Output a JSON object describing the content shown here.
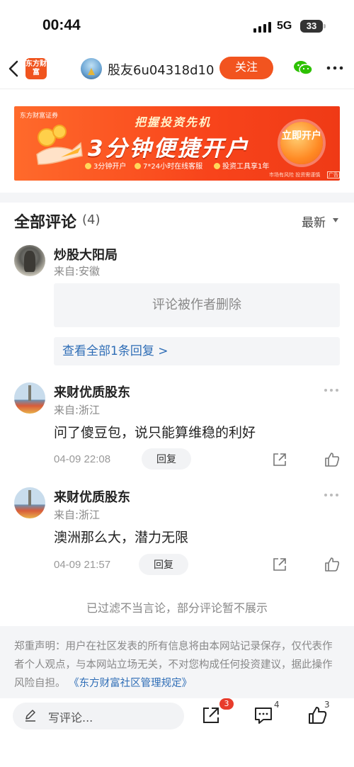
{
  "status_bar": {
    "time": "00:44",
    "network": "5G",
    "battery": "33"
  },
  "nav": {
    "logo_text": "东方财富",
    "username": "股友6u04318d10",
    "follow_label": "关注"
  },
  "banner": {
    "brand": "东方财富证券",
    "subtitle": "把握投资先机",
    "title": "3分钟便捷开户",
    "features": [
      "3分钟开户",
      "7*24小时在线客服",
      "投资工具享1年"
    ],
    "cta": "立即开户",
    "risk_note": "市场有风险 投资需谨慎",
    "ad_tag": "广告"
  },
  "comments_header": {
    "title": "全部评论",
    "count": "(4)",
    "sort_label": "最新"
  },
  "comments": [
    {
      "user": "炒股大阳局",
      "location": "来自:安徽",
      "deleted_text": "评论被作者删除",
      "view_replies": "查看全部1条回复 >"
    },
    {
      "user": "来财优质股东",
      "location": "来自:浙江",
      "text": "问了傻豆包，说只能算维稳的利好",
      "time": "04-09 22:08",
      "reply_label": "回复"
    },
    {
      "user": "来财优质股东",
      "location": "来自:浙江",
      "text": "澳洲那么大，潜力无限",
      "time": "04-09 21:57",
      "reply_label": "回复"
    }
  ],
  "filtered_notice": "已过滤不当言论，部分评论暂不展示",
  "disclaimer": {
    "text": "郑重声明：用户在社区发表的所有信息将由本网站记录保存，仅代表作者个人观点，与本网站立场无关，不对您构成任何投资建议，据此操作风险自担。",
    "link": "《东方财富社区管理规定》"
  },
  "bottom_bar": {
    "write_placeholder": "写评论...",
    "share_count": "3",
    "comment_count": "4",
    "like_count": "3"
  },
  "colors": {
    "accent": "#f2541f",
    "link": "#2e6db6",
    "badge": "#e83c2c"
  }
}
